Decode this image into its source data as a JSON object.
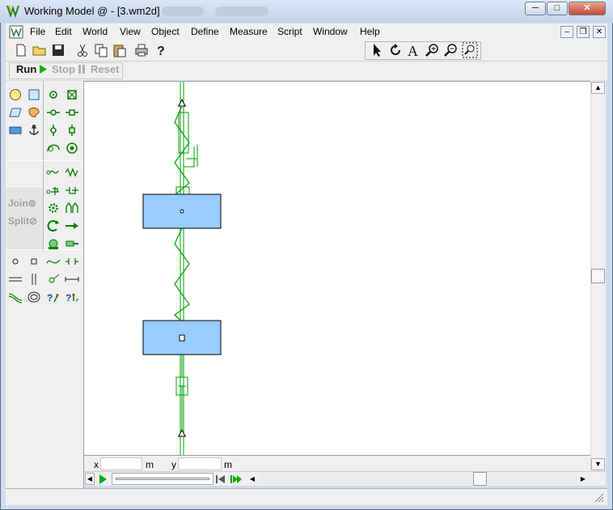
{
  "window": {
    "title": "Working Model @ - [3.wm2d]",
    "caption_buttons": {
      "minimize": "─",
      "maximize": "□",
      "close": "✕"
    }
  },
  "menu": {
    "items": [
      {
        "label": "File"
      },
      {
        "label": "Edit"
      },
      {
        "label": "World"
      },
      {
        "label": "View"
      },
      {
        "label": "Object"
      },
      {
        "label": "Define"
      },
      {
        "label": "Measure"
      },
      {
        "label": "Script"
      },
      {
        "label": "Window"
      },
      {
        "label": "Help"
      }
    ],
    "mdi_buttons": {
      "minimize": "–",
      "restore": "❐",
      "close": "✕"
    }
  },
  "run_controls": {
    "run": "Run",
    "stop": "Stop",
    "reset": "Reset"
  },
  "palette": {
    "join": "Join",
    "split": "Split"
  },
  "coords": {
    "x_label": "x",
    "x_value": "",
    "x_unit": "m",
    "y_label": "y",
    "y_value": "",
    "y_unit": "m"
  },
  "icons": {
    "new": "new-file-icon",
    "open": "open-folder-icon",
    "save": "save-disk-icon",
    "cut": "scissors-icon",
    "copy": "copy-icon",
    "paste": "paste-icon",
    "print": "printer-icon",
    "help": "help-question-icon",
    "select": "arrow-pointer-icon",
    "rotate": "rotate-icon",
    "text": "text-tool-icon",
    "zoom_in": "zoom-in-icon",
    "zoom_out": "zoom-out-icon",
    "zoom_fit": "zoom-fit-icon"
  },
  "colors": {
    "body_fill": "#99ccff",
    "constraint_green": "#00a000",
    "run_green": "#00b000"
  }
}
